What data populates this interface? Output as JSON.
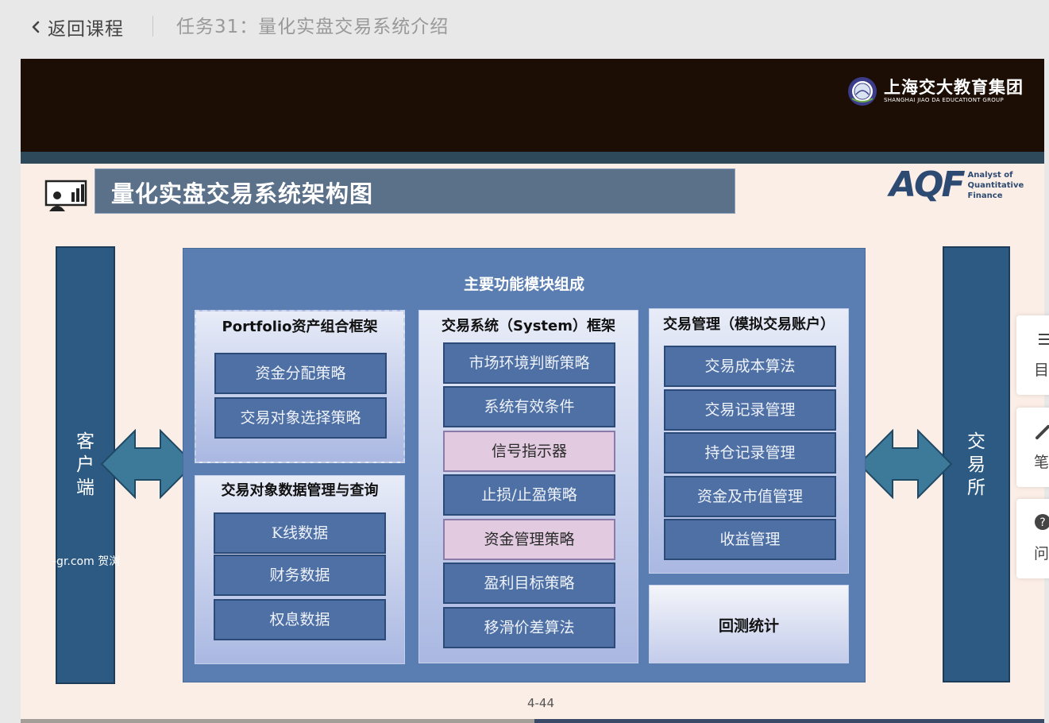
{
  "topbar": {
    "back_label": "返回课程",
    "task_title": "任务31：量化实盘交易系统介绍"
  },
  "slide": {
    "logo_cn": "上海交大教育集团",
    "logo_en": "SHANGHAI JIAO DA EDUCATIONT GROUP",
    "title": "量化实盘交易系统架构图",
    "aqf_mark": "AQF",
    "aqf_line1": "Analyst of",
    "aqf_line2": "Quantitative Finance",
    "left_column": "客户端",
    "right_column": "交易所",
    "watermark": "-gr.com 贺浏",
    "main_heading": "主要功能模块组成",
    "panels": {
      "portfolio": {
        "title": "Portfolio资产组合框架",
        "items": [
          "资金分配策略",
          "交易对象选择策略"
        ]
      },
      "data": {
        "title": "交易对象数据管理与查询",
        "items": [
          "K线数据",
          "财务数据",
          "权息数据"
        ]
      },
      "system": {
        "title": "交易系统（System）框架",
        "items": [
          "市场环境判断策略",
          "系统有效条件",
          "信号指示器",
          "止损/止盈策略",
          "资金管理策略",
          "盈利目标策略",
          "移滑价差算法"
        ]
      },
      "trade_mgmt": {
        "title": "交易管理（模拟交易账户）",
        "items": [
          "交易成本算法",
          "交易记录管理",
          "持仓记录管理",
          "资金及市值管理",
          "收益管理"
        ]
      }
    },
    "backtest": "回测统计",
    "page_number": "4-44"
  },
  "float_panel": {
    "items": [
      {
        "icon": "catalog-icon",
        "label": "目"
      },
      {
        "icon": "pen-icon",
        "label": "笔"
      },
      {
        "icon": "question-icon",
        "label": "问"
      }
    ]
  },
  "colors": {
    "header_dark": "#1c0e05",
    "slide_bg": "#fbeee6",
    "main_blue": "#5a7eb1",
    "column_blue": "#2c5a83",
    "item_blue": "#4f70a4",
    "item_pink": "#e2cbe0",
    "arrow_teal": "#3d7a99"
  }
}
